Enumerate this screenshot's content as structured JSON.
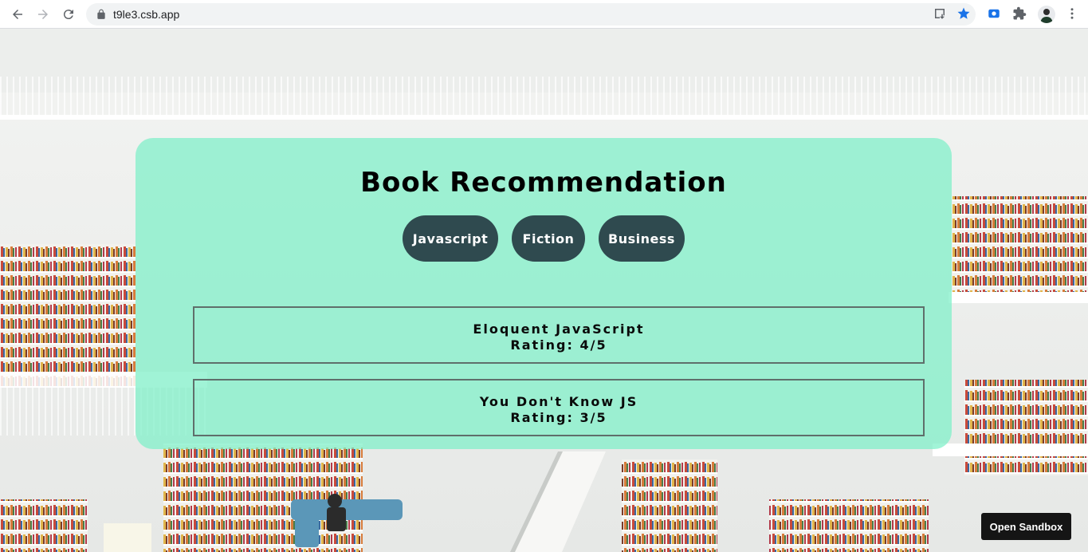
{
  "browser": {
    "url": "t9le3.csb.app",
    "accent": "#1a73e8"
  },
  "app": {
    "title": "Book Recommendation",
    "genres": [
      {
        "label": "Javascript"
      },
      {
        "label": "Fiction"
      },
      {
        "label": "Business"
      }
    ],
    "books": [
      {
        "name": "Eloquent JavaScript",
        "rating": "Rating: 4/5"
      },
      {
        "name": "You Don't Know JS",
        "rating": "Rating: 3/5"
      }
    ],
    "panel_color": "#7df0c8",
    "button_color": "#2f4a4f"
  },
  "sandbox": {
    "open_label": "Open Sandbox"
  }
}
